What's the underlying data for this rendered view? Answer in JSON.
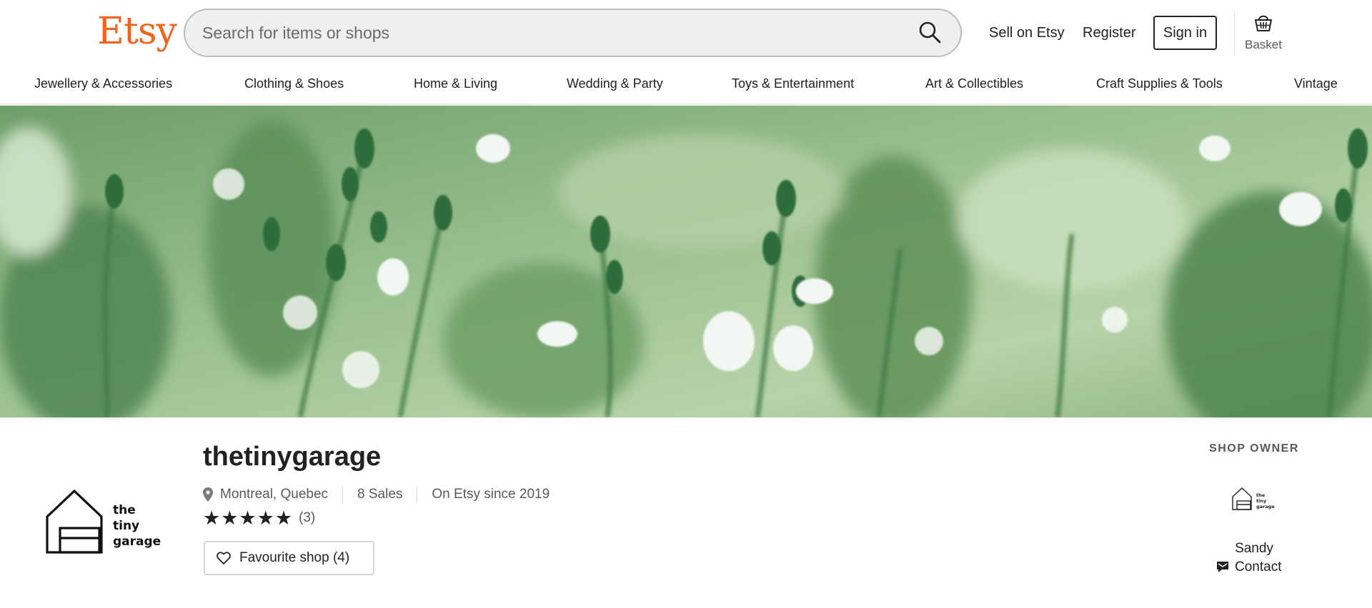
{
  "header": {
    "logo": "Etsy",
    "search_placeholder": "Search for items or shops",
    "sell_label": "Sell on Etsy",
    "register_label": "Register",
    "signin_label": "Sign in",
    "basket_label": "Basket"
  },
  "categories": [
    "Jewellery & Accessories",
    "Clothing & Shoes",
    "Home & Living",
    "Wedding & Party",
    "Toys & Entertainment",
    "Art & Collectibles",
    "Craft Supplies & Tools",
    "Vintage"
  ],
  "shop": {
    "name": "thetinygarage",
    "logo_text": [
      "the",
      "tiny",
      "garage"
    ],
    "location": "Montreal, Quebec",
    "sales": "8 Sales",
    "since": "On Etsy since 2019",
    "stars": "★★★★★",
    "rating_value": 5,
    "rating_count": "(3)",
    "favourite_label": "Favourite shop (4)"
  },
  "owner": {
    "title": "SHOP OWNER",
    "name": "Sandy",
    "contact_label": "Contact"
  },
  "colors": {
    "brand": "#f1641e",
    "banner_green": "#9bbf8f"
  }
}
